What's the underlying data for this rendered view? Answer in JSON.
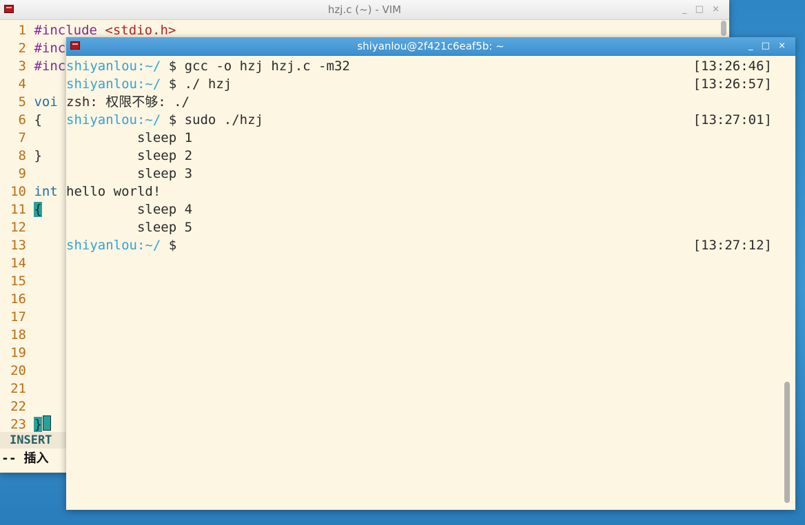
{
  "vim": {
    "title": "hzj.c (~) - VIM",
    "wm_buttons": [
      "_",
      "□",
      "×"
    ],
    "lines": [
      {
        "n": "1",
        "tokens": [
          {
            "t": "#include ",
            "c": "pp"
          },
          {
            "t": "<stdio.h>",
            "c": "inc"
          }
        ]
      },
      {
        "n": "2",
        "tokens": [
          {
            "t": "#inc",
            "c": "pp"
          }
        ]
      },
      {
        "n": "3",
        "tokens": [
          {
            "t": "#inc",
            "c": "pp"
          }
        ]
      },
      {
        "n": "4",
        "tokens": []
      },
      {
        "n": "5",
        "tokens": [
          {
            "t": "voi",
            "c": "kw"
          }
        ]
      },
      {
        "n": "6",
        "tokens": [
          {
            "t": "{",
            "c": "vtxt"
          }
        ]
      },
      {
        "n": "7",
        "tokens": []
      },
      {
        "n": "8",
        "tokens": [
          {
            "t": "}",
            "c": "vtxt"
          }
        ]
      },
      {
        "n": "9",
        "tokens": []
      },
      {
        "n": "10",
        "tokens": [
          {
            "t": "int",
            "c": "kw"
          }
        ]
      },
      {
        "n": "11",
        "tokens": [
          {
            "t": "{",
            "c": "brace-hl"
          }
        ]
      },
      {
        "n": "12",
        "tokens": []
      },
      {
        "n": "13",
        "tokens": []
      },
      {
        "n": "14",
        "tokens": []
      },
      {
        "n": "15",
        "tokens": []
      },
      {
        "n": "16",
        "tokens": []
      },
      {
        "n": "17",
        "tokens": []
      },
      {
        "n": "18",
        "tokens": []
      },
      {
        "n": "19",
        "tokens": []
      },
      {
        "n": "20",
        "tokens": []
      },
      {
        "n": "21",
        "tokens": []
      },
      {
        "n": "22",
        "tokens": []
      },
      {
        "n": "23",
        "tokens": [
          {
            "t": "}",
            "c": "brace-hl"
          }
        ]
      }
    ],
    "mode": "INSERT",
    "message": "-- 插入"
  },
  "terminal": {
    "title": "shiyanlou@2f421c6eaf5b: ~",
    "wm_buttons": [
      "_",
      "□",
      "×"
    ],
    "lines": [
      {
        "user": "shiyanlou",
        "path": ":~/",
        "cmd": " $ gcc -o hzj hzj.c -m32",
        "time": "[13:26:46]"
      },
      {
        "user": "shiyanlou",
        "path": ":~/",
        "cmd": " $ ./ hzj",
        "time": "[13:26:57]"
      },
      {
        "text": "zsh: 权限不够: ./"
      },
      {
        "user": "shiyanlou",
        "path": ":~/",
        "cmd": " $ sudo ./hzj",
        "time": "[13:27:01]"
      },
      {
        "text": "         sleep 1"
      },
      {
        "text": "         sleep 2"
      },
      {
        "text": "         sleep 3"
      },
      {
        "text": "hello world!"
      },
      {
        "text": "         sleep 4"
      },
      {
        "text": "         sleep 5"
      },
      {
        "user": "shiyanlou",
        "path": ":~/",
        "cmd": " $",
        "time": "[13:27:12]"
      }
    ]
  },
  "colors": {
    "background": "#fdf6e3",
    "prompt": "#31a3d4",
    "line_number": "#c06b10",
    "keyword": "#1f6f9e",
    "preproc": "#7e2b8f"
  }
}
